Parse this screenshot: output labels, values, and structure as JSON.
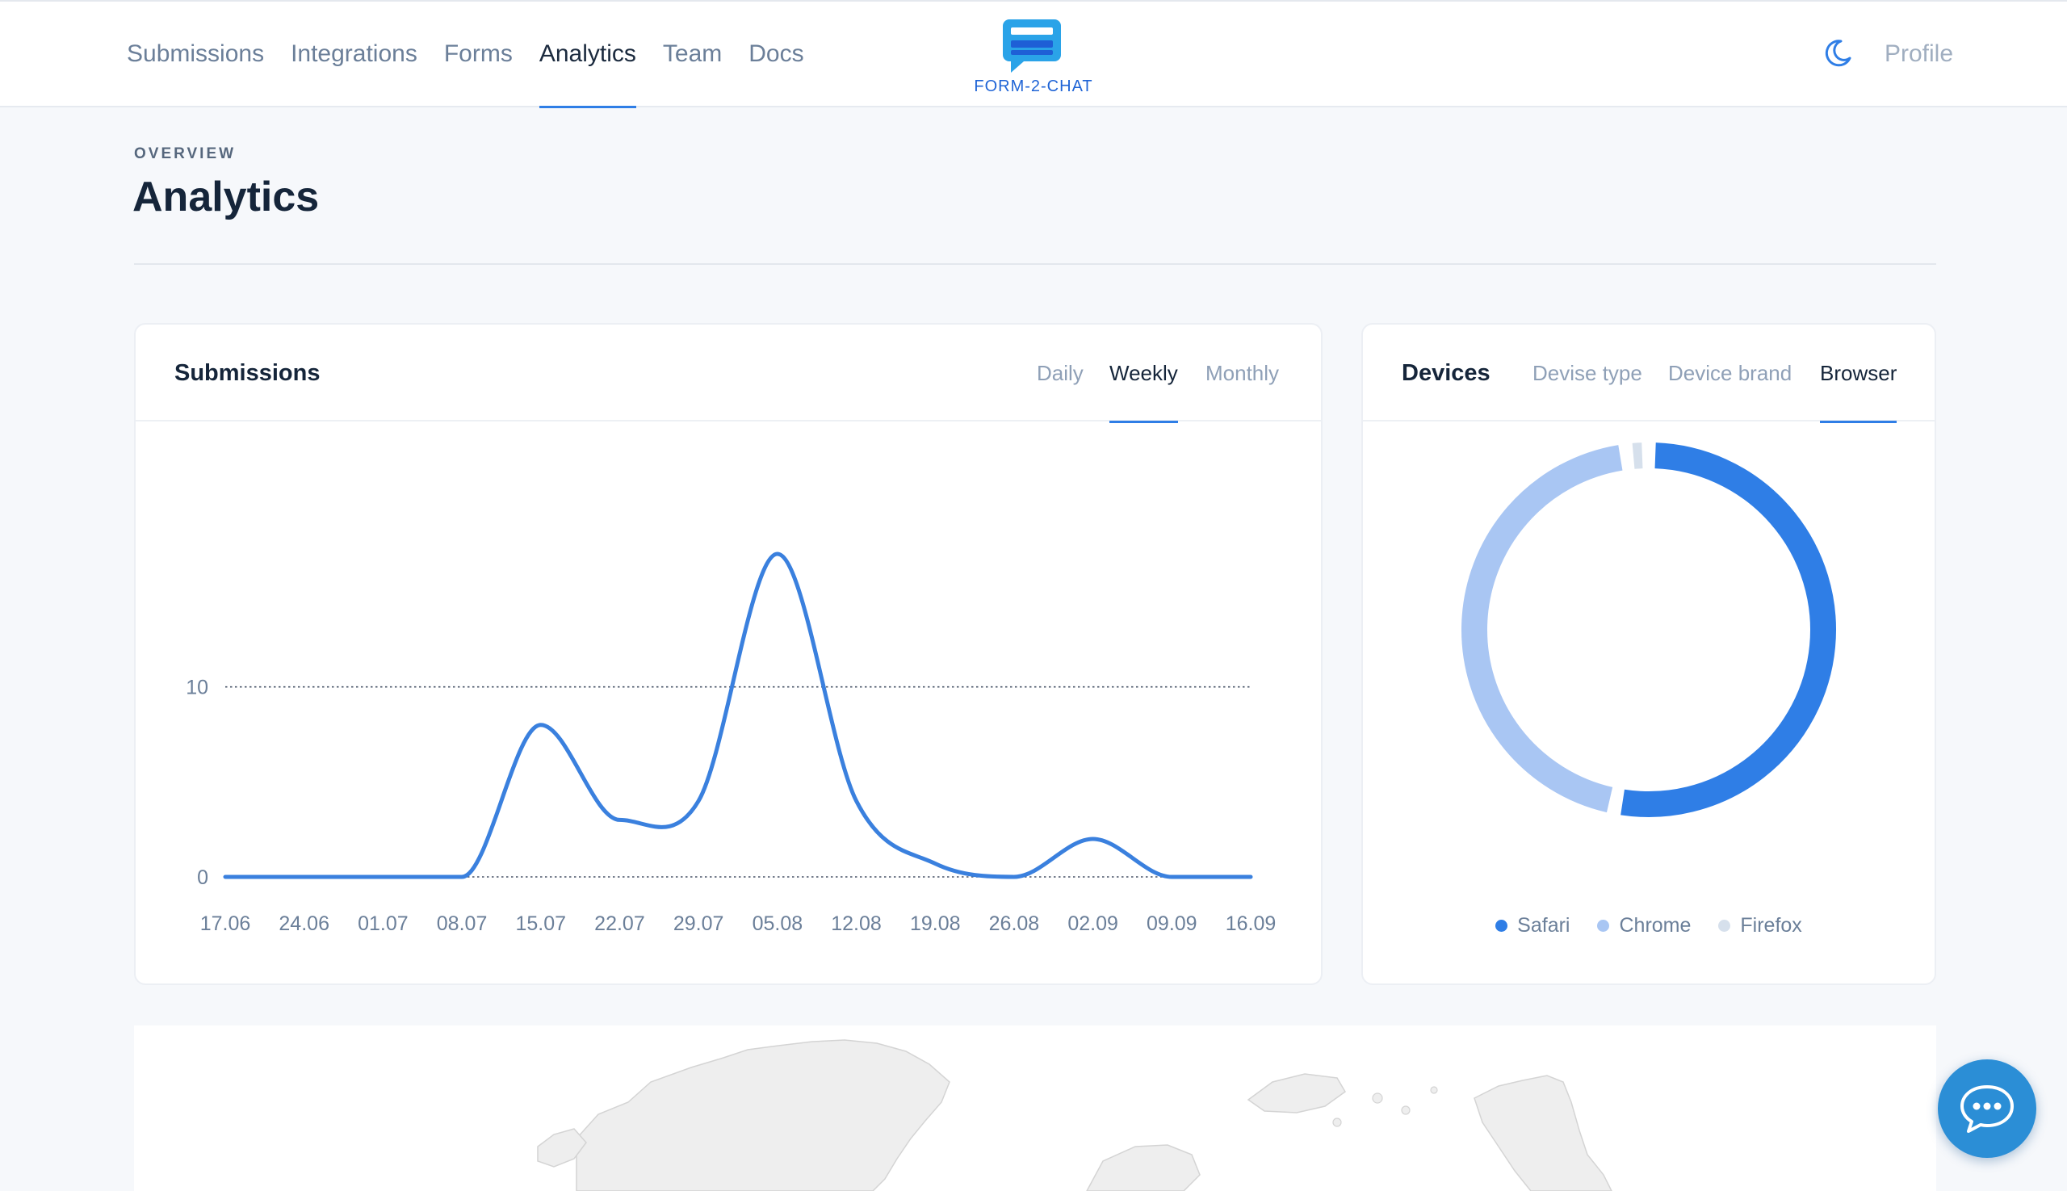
{
  "nav": {
    "items": [
      {
        "label": "Submissions",
        "active": false
      },
      {
        "label": "Integrations",
        "active": false
      },
      {
        "label": "Forms",
        "active": false
      },
      {
        "label": "Analytics",
        "active": true
      },
      {
        "label": "Team",
        "active": false
      },
      {
        "label": "Docs",
        "active": false
      }
    ],
    "logo_text": "FORM-2-CHAT",
    "theme_icon": "moon-icon",
    "profile_label": "Profile"
  },
  "header": {
    "eyebrow": "OVERVIEW",
    "title": "Analytics"
  },
  "submissions_card": {
    "title": "Submissions",
    "tabs": [
      {
        "label": "Daily",
        "active": false
      },
      {
        "label": "Weekly",
        "active": true
      },
      {
        "label": "Monthly",
        "active": false
      }
    ]
  },
  "devices_card": {
    "title": "Devices",
    "tabs": [
      {
        "label": "Devise type",
        "active": false
      },
      {
        "label": "Device brand",
        "active": false
      },
      {
        "label": "Browser",
        "active": true
      }
    ]
  },
  "colors": {
    "accent": "#2f7ee6",
    "line": "#3a80de",
    "safari": "#2f7ee6",
    "chrome": "#a9c6f3",
    "firefox": "#d6e0ec"
  },
  "chart_data": [
    {
      "type": "line",
      "smooth": true,
      "x": [
        "17.06",
        "24.06",
        "01.07",
        "08.07",
        "15.07",
        "22.07",
        "29.07",
        "05.08",
        "12.08",
        "19.08",
        "26.08",
        "02.09",
        "09.09",
        "16.09"
      ],
      "series": [
        {
          "values": [
            0,
            0,
            0,
            0,
            8,
            3,
            4,
            17,
            4,
            0.7,
            0,
            2,
            0,
            0
          ]
        }
      ],
      "ylim": [
        0,
        17
      ],
      "yticks": [
        0,
        10
      ],
      "grid": "dotted horizontal at ticks"
    },
    {
      "type": "pie",
      "donut": true,
      "labels": [
        "Safari",
        "Chrome",
        "Firefox"
      ],
      "values": [
        53,
        45,
        2
      ],
      "legend": "bottom"
    }
  ]
}
